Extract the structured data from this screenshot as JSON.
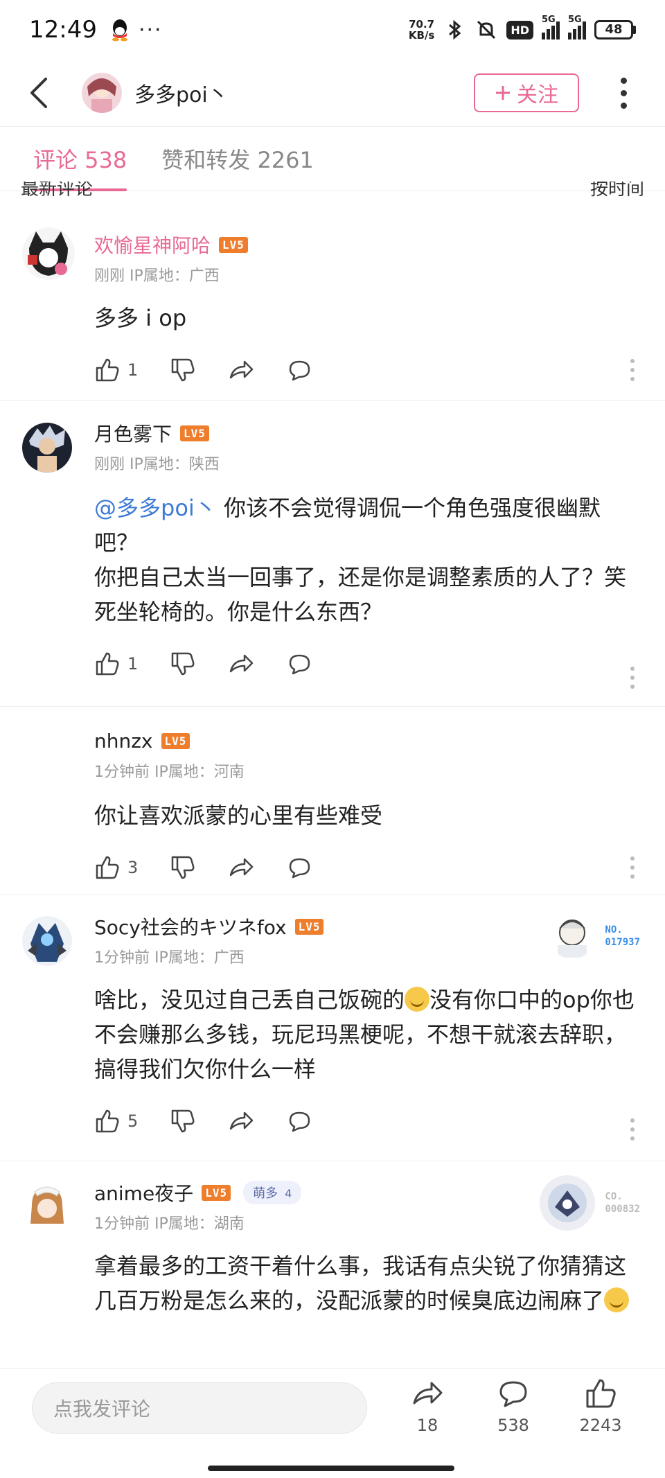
{
  "status": {
    "time": "12:49",
    "dots": "···",
    "speed_value": "70.7",
    "speed_unit": "KB/s",
    "hd": "HD",
    "sig1": "5G",
    "sig2": "5G",
    "battery": "48"
  },
  "header": {
    "username": "多多poi丶",
    "follow_label": "关注"
  },
  "tabs": [
    {
      "label": "评论 538"
    },
    {
      "label": "赞和转发 2261"
    }
  ],
  "subhead": {
    "left": "最新评论",
    "right": "按时间"
  },
  "comments": [
    {
      "name": "欢愉星神阿哈",
      "level": "LV5",
      "meta": "刚刚 IP属地：广西",
      "text": "多多 i  op",
      "likes": "1"
    },
    {
      "name": "月色雾下",
      "level": "LV5",
      "meta": "刚刚 IP属地：陕西",
      "mention": "@多多poi丶",
      "text": " 你该不会觉得调侃一个角色强度很幽默吧？\n你把自己太当一回事了，还是你是调整素质的人了？笑死坐轮椅的。你是什么东西？",
      "likes": "1"
    },
    {
      "name": "nhnzx",
      "level": "LV5",
      "meta": "1分钟前 IP属地：河南",
      "text": "你让喜欢派蒙的心里有些难受",
      "likes": "3"
    },
    {
      "name": "Socy社会的キツネfox",
      "level": "LV5",
      "meta": "1分钟前 IP属地：广西",
      "text_a": "啥比，没见过自己丢自己饭碗的",
      "text_b": "没有你口中的op你也不会赚那么多钱，玩尼玛黑梗呢，不想干就滚去辞职，搞得我们欠你什么一样",
      "likes": "5",
      "pendant_no_1": "NO.",
      "pendant_no_2": "017937"
    },
    {
      "name": "anime夜子",
      "level": "LV5",
      "fan_badge": "萌多",
      "fan_level": "4",
      "meta": "1分钟前 IP属地：湖南",
      "text": "拿着最多的工资干着什么事，我话有点尖锐了你猜猜这几百万粉是怎么来的，没配派蒙的时候臭底边闹麻了",
      "pendant_no_1": "CO.",
      "pendant_no_2": "000832"
    }
  ],
  "bottom": {
    "placeholder": "点我发评论",
    "forward_count": "18",
    "comment_count": "538",
    "like_count": "2243"
  },
  "colors": {
    "accent": "#e86a92",
    "mention": "#3d7bd6",
    "level_badge": "#ee7d2c"
  }
}
